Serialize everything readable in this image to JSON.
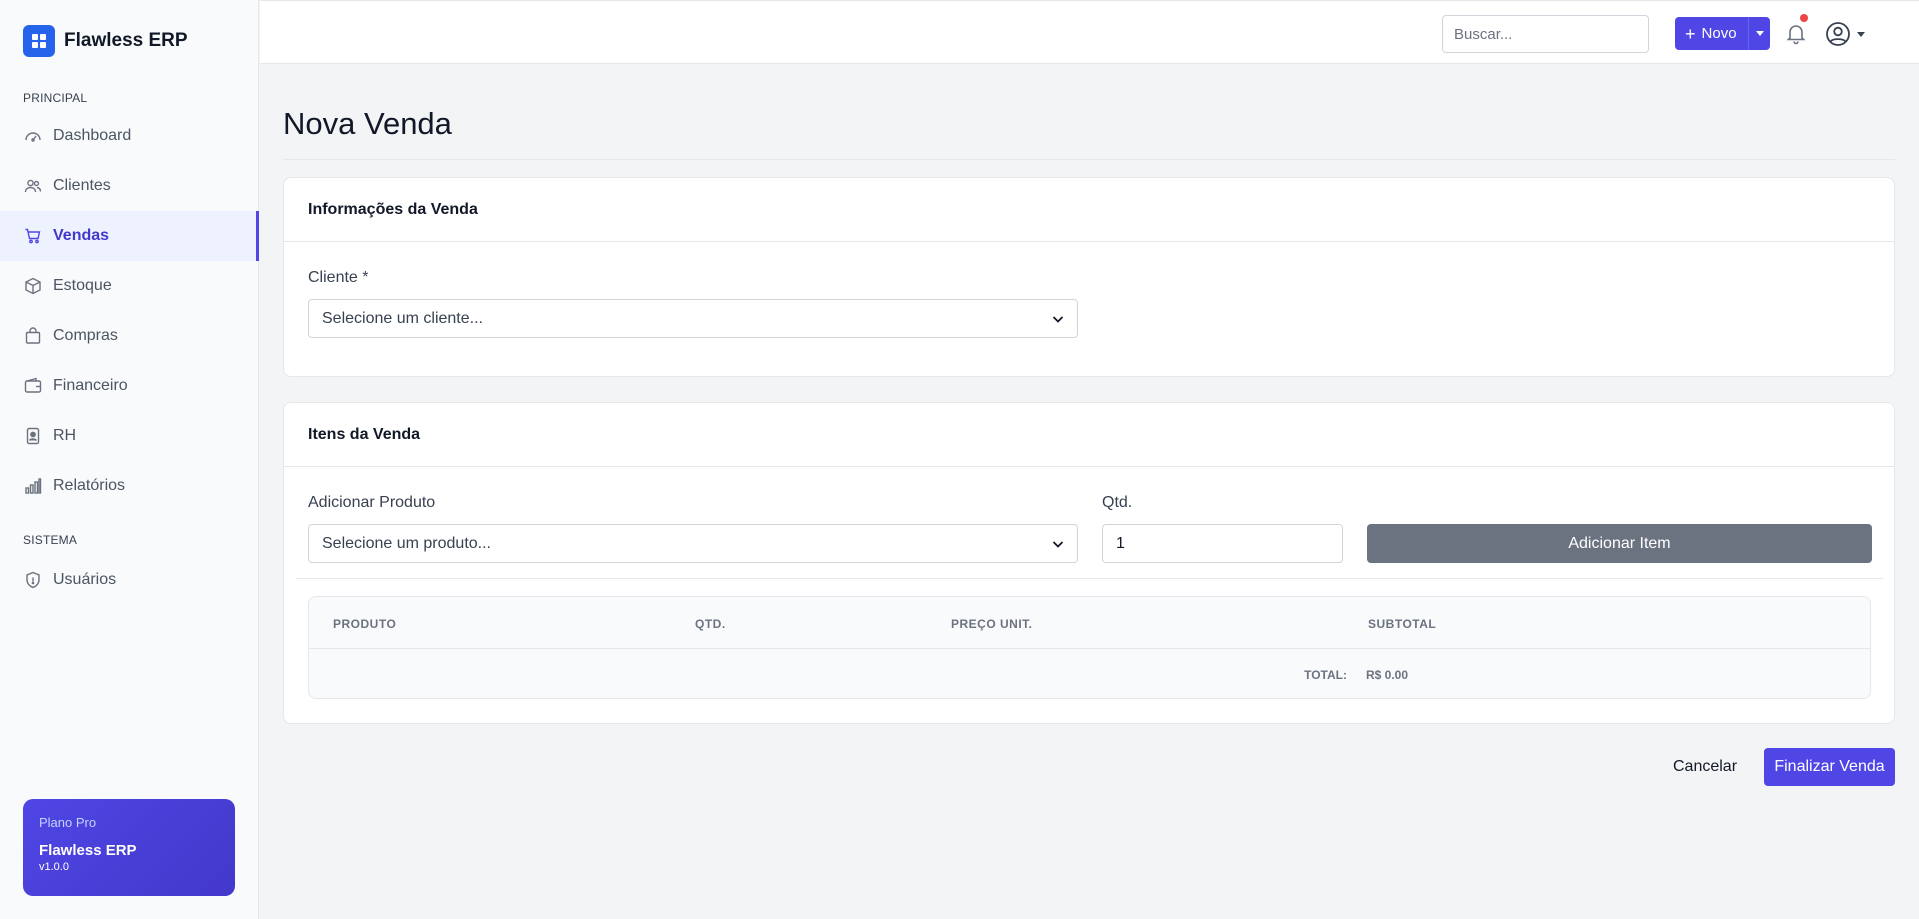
{
  "brand": {
    "name": "Flawless ERP",
    "icon": "grid-icon",
    "color": "#2563eb"
  },
  "sidebar": {
    "sections": [
      {
        "label": "PRINCIPAL",
        "items": [
          {
            "label": "Dashboard",
            "icon": "gauge-icon",
            "active": false
          },
          {
            "label": "Clientes",
            "icon": "users-icon",
            "active": false
          },
          {
            "label": "Vendas",
            "icon": "cart-icon",
            "active": true
          },
          {
            "label": "Estoque",
            "icon": "box-icon",
            "active": false
          },
          {
            "label": "Compras",
            "icon": "bag-icon",
            "active": false
          },
          {
            "label": "Financeiro",
            "icon": "wallet-icon",
            "active": false
          },
          {
            "label": "RH",
            "icon": "badge-icon",
            "active": false
          },
          {
            "label": "Relatórios",
            "icon": "bar-chart-icon",
            "active": false
          }
        ]
      },
      {
        "label": "SISTEMA",
        "items": [
          {
            "label": "Usuários",
            "icon": "shield-icon",
            "active": false
          }
        ]
      }
    ],
    "plan": {
      "label": "Plano Pro",
      "name": "Flawless ERP",
      "version": "v1.0.0"
    }
  },
  "topbar": {
    "search_placeholder": "Buscar...",
    "new_button": "Novo",
    "accent": "#4f46e5",
    "notification_color": "#ef4444"
  },
  "page": {
    "title": "Nova Venda",
    "sale_info": {
      "title": "Informações da Venda",
      "client_label": "Cliente *",
      "client_select": "Selecione um cliente..."
    },
    "items": {
      "title": "Itens da Venda",
      "product_label": "Adicionar Produto",
      "product_select": "Selecione um produto...",
      "qty_label": "Qtd.",
      "qty_value": "1",
      "add_button": "Adicionar Item",
      "table": {
        "columns": [
          "PRODUTO",
          "QTD.",
          "PREÇO UNIT.",
          "SUBTOTAL"
        ],
        "rows": [],
        "total_label": "TOTAL:",
        "total_value": "R$ 0.00"
      }
    },
    "actions": {
      "cancel": "Cancelar",
      "finalize": "Finalizar Venda"
    }
  }
}
